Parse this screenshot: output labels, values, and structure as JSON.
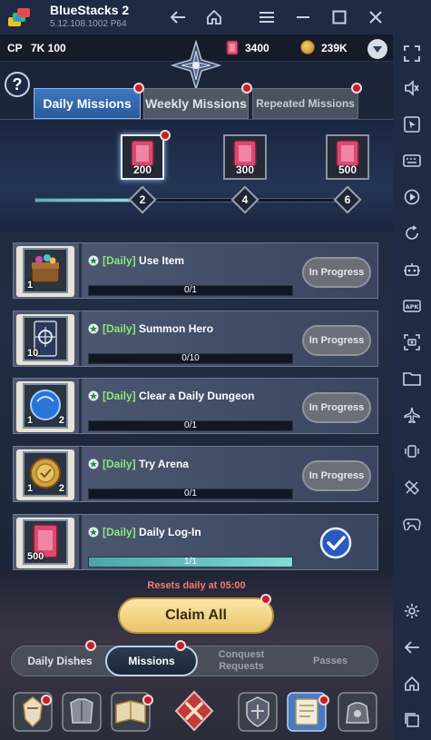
{
  "window": {
    "app_title": "BlueStacks 2",
    "version": "5.12.108.1002 P64"
  },
  "status": {
    "cp_label": "CP",
    "cp_value": "7K 100",
    "gems": "3400",
    "gold": "239K"
  },
  "help_label": "?",
  "tabs": [
    {
      "label": "Daily Missions",
      "active": true
    },
    {
      "label": "Weekly Missions",
      "active": false
    },
    {
      "label": "Repeated Missions",
      "active": false
    }
  ],
  "rewards": [
    {
      "amount": "200",
      "milestone": "2"
    },
    {
      "amount": "300",
      "milestone": "4"
    },
    {
      "amount": "500",
      "milestone": "6"
    }
  ],
  "reward_progress": 0.33,
  "missions": [
    {
      "tag": "[Daily]",
      "name": "Use Item",
      "qty": "1",
      "key": "",
      "progress": "0/1",
      "fill": 0,
      "status": "In Progress",
      "icon": "treasure-chest-icon"
    },
    {
      "tag": "[Daily]",
      "name": "Summon Hero",
      "qty": "10",
      "key": "",
      "progress": "0/10",
      "fill": 0,
      "status": "In Progress",
      "icon": "summon-ticket-icon"
    },
    {
      "tag": "[Daily]",
      "name": "Clear a Daily Dungeon",
      "qty": "1",
      "key": "2",
      "progress": "0/1",
      "fill": 0,
      "status": "In Progress",
      "icon": "blue-orb-icon"
    },
    {
      "tag": "[Daily]",
      "name": "Try Arena",
      "qty": "1",
      "key": "2",
      "progress": "0/1",
      "fill": 0,
      "status": "In Progress",
      "icon": "arena-medal-icon"
    },
    {
      "tag": "[Daily]",
      "name": "Daily Log-In",
      "qty": "500",
      "key": "",
      "progress": "1/1",
      "fill": 1,
      "status": "",
      "icon": "gem-icon"
    }
  ],
  "footer": {
    "resets_text": "Resets daily at 05:00",
    "claim_label": "Claim All"
  },
  "bottom_tabs": [
    {
      "label": "Daily Dishes"
    },
    {
      "label": "Missions"
    },
    {
      "label": "Conquest Requests"
    },
    {
      "label": "Passes"
    }
  ],
  "colors": {
    "accent_blue": "#3e78c0",
    "daily_tag_green": "#8de67a",
    "claim_gold": "#e9c46a",
    "notification_red": "#c4202a"
  }
}
